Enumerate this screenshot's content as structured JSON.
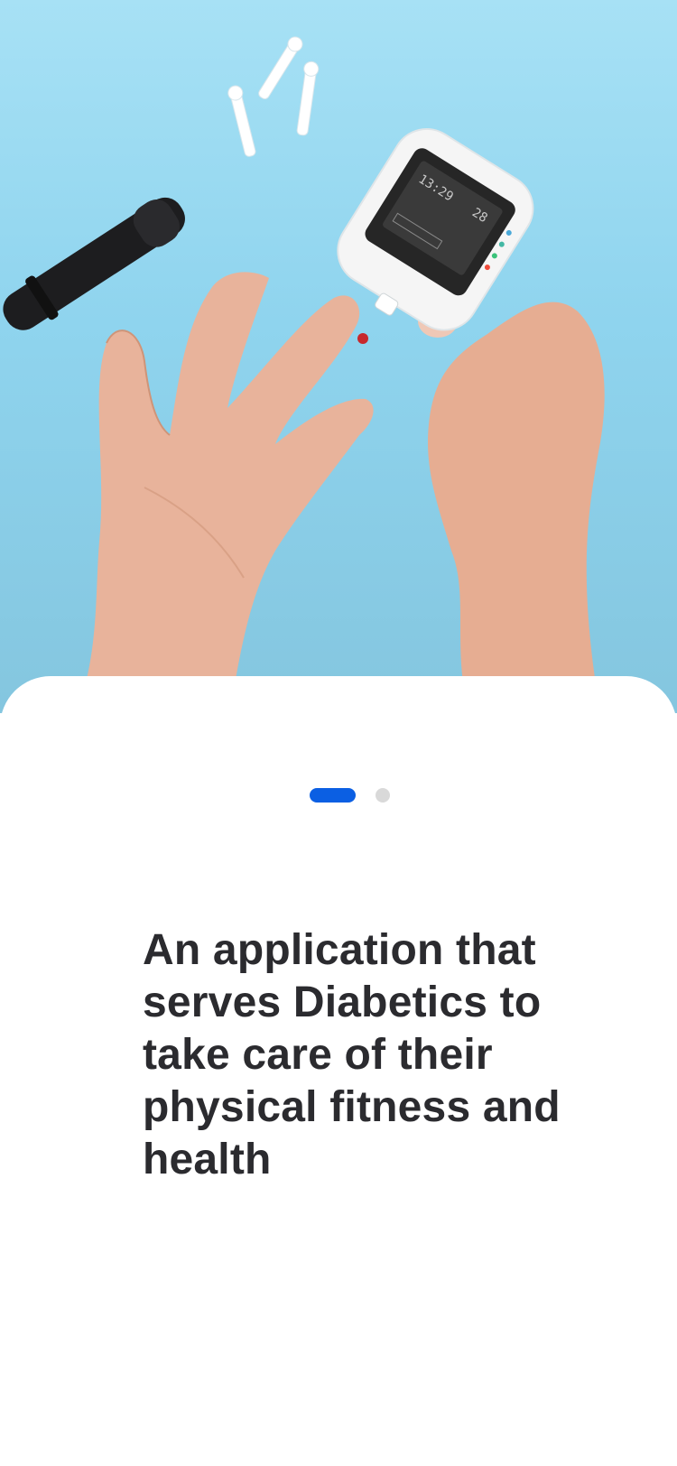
{
  "onboarding": {
    "headline": "An application that serves Diabetics to take care of their physical fitness and health",
    "pager": {
      "total_pages": 2,
      "active_page": 1
    },
    "hero_image": {
      "meter_screen_left": "13:29",
      "meter_screen_right": "28"
    }
  },
  "colors": {
    "hero_background": "#9fdcf2",
    "pager_active": "#0b5fe3",
    "pager_inactive": "#d9d9d9",
    "headline_text": "#2b2b2f"
  }
}
